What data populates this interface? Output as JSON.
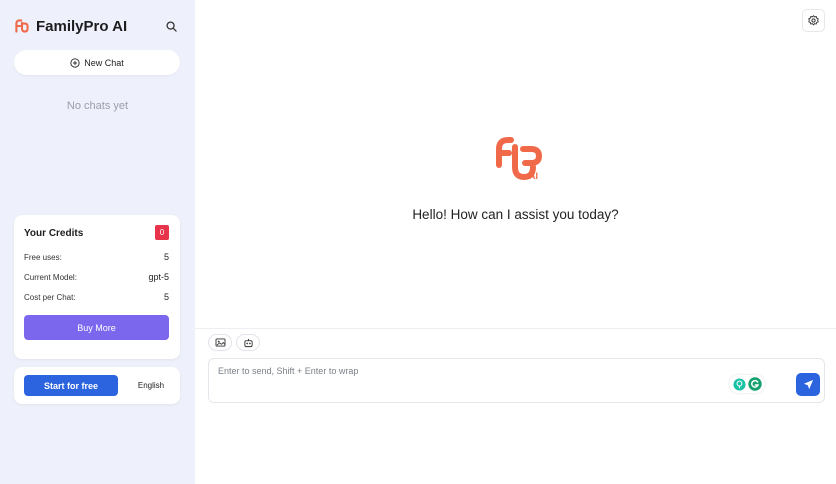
{
  "app": {
    "name": "FamilyPro AI",
    "brand_color": "#f06a4a"
  },
  "sidebar": {
    "search_icon": "search-icon",
    "new_chat_label": "New Chat",
    "empty_state": "No chats yet",
    "credits": {
      "title": "Your Credits",
      "badge": "0",
      "rows": [
        {
          "label": "Free uses:",
          "value": "5"
        },
        {
          "label": "Current Model:",
          "value": "gpt-5"
        },
        {
          "label": "Cost per Chat:",
          "value": "5"
        }
      ],
      "buy_more_label": "Buy More"
    },
    "footer": {
      "start_label": "Start for free",
      "language": "English"
    }
  },
  "main": {
    "logo_suffix": "AI",
    "greeting": "Hello! How can I assist you today?",
    "input_placeholder": "Enter to send, Shift + Enter to wrap",
    "tools": [
      "image-tool-icon",
      "robot-icon"
    ]
  },
  "colors": {
    "sidebar_bg": "#eef0fb",
    "accent_blue": "#2c63df",
    "accent_purple": "#7b66ee",
    "badge_red": "#e8334a"
  }
}
